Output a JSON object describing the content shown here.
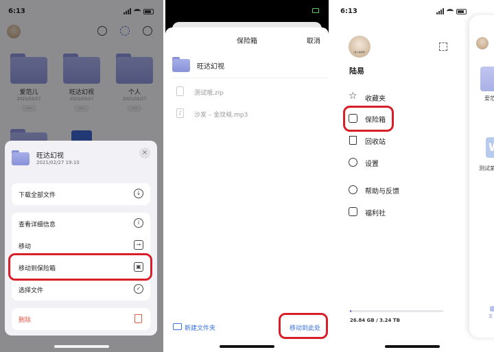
{
  "screen1": {
    "status_time": "6:13",
    "folders": [
      {
        "name": "爱范儿",
        "date": "2021/02/27",
        "more": "..."
      },
      {
        "name": "旺达幻视",
        "date": "2021/02/27",
        "more": "..."
      },
      {
        "name": "个人",
        "date": "2021/02/27",
        "more": "..."
      }
    ],
    "sheet": {
      "title": "旺达幻视",
      "subtitle": "2021/02/27 19:10",
      "close": "×",
      "items": {
        "download": "下载全部文件",
        "details": "查看详细信息",
        "move": "移动",
        "move_to_vault": "移动到保险箱",
        "select": "选择文件",
        "delete": "删除"
      },
      "icons": {
        "download": "↓",
        "details": "i",
        "move": "→",
        "vault": "▣",
        "select": "✓",
        "delete": "🗑"
      }
    },
    "colors": {
      "highlight": "#d81e28",
      "delete": "#e05a4a",
      "folder": "#9aa2e2"
    }
  },
  "screen2": {
    "title": "保险箱",
    "cancel": "取消",
    "folder_name": "旺达幻视",
    "files": [
      "测试哦.zip",
      "沙发 – 金玟岐.mp3"
    ],
    "new_folder": "新建文件夹",
    "move_here": "移动到此处",
    "colors": {
      "link": "#3a72e0"
    }
  },
  "screen3": {
    "status_time": "6:13",
    "avatar_caption": "\"给人来摸摸\"",
    "user_name": "陆易",
    "menu": [
      {
        "label": "收藏夹",
        "icon": "star-icon"
      },
      {
        "label": "保险箱",
        "icon": "vault-icon"
      },
      {
        "label": "回收站",
        "icon": "trash-icon"
      },
      {
        "label": "设置",
        "icon": "settings-icon"
      },
      {
        "label": "帮助与反馈",
        "icon": "smile-icon"
      },
      {
        "label": "福利社",
        "icon": "gift-icon"
      }
    ],
    "storage": "26.84 GB / 3.24 TB",
    "storage_fraction": 0.0081,
    "peek": {
      "name1": "爱范",
      "name2": "测试第",
      "tile": "W",
      "tab": "文"
    }
  }
}
